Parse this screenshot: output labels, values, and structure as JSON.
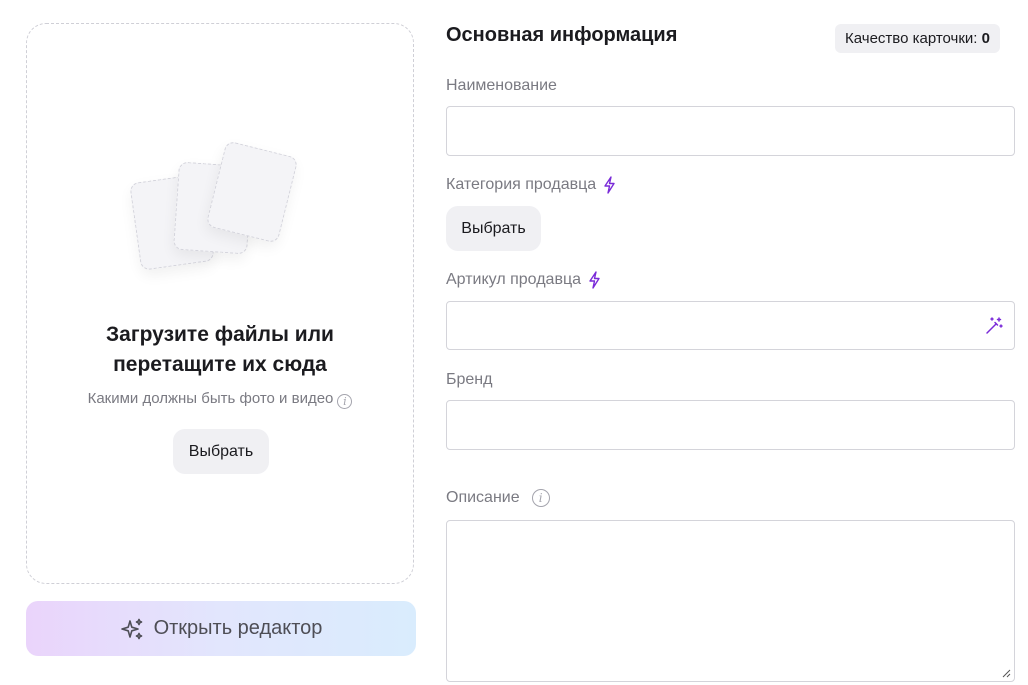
{
  "upload": {
    "title_line1": "Загрузите файлы или",
    "title_line2": "перетащите их сюда",
    "hint": "Какими должны быть фото и видео",
    "select_label": "Выбрать"
  },
  "editor": {
    "label": "Открыть редактор"
  },
  "form": {
    "section_title": "Основная информация",
    "quality_label": "Качество карточки:",
    "quality_value": "0",
    "name_label": "Наименование",
    "name_value": "",
    "category_label": "Категория продавца",
    "category_button": "Выбрать",
    "article_label": "Артикул продавца",
    "article_value": "",
    "brand_label": "Бренд",
    "brand_value": "",
    "description_label": "Описание",
    "description_value": ""
  },
  "colors": {
    "accent": "#7a2bd8",
    "label": "#7a7a82",
    "border": "#d4d4da"
  },
  "icons": [
    "bolt-icon",
    "magic-wand-icon",
    "info-icon",
    "sparkle-icon",
    "resize-handle-icon"
  ]
}
